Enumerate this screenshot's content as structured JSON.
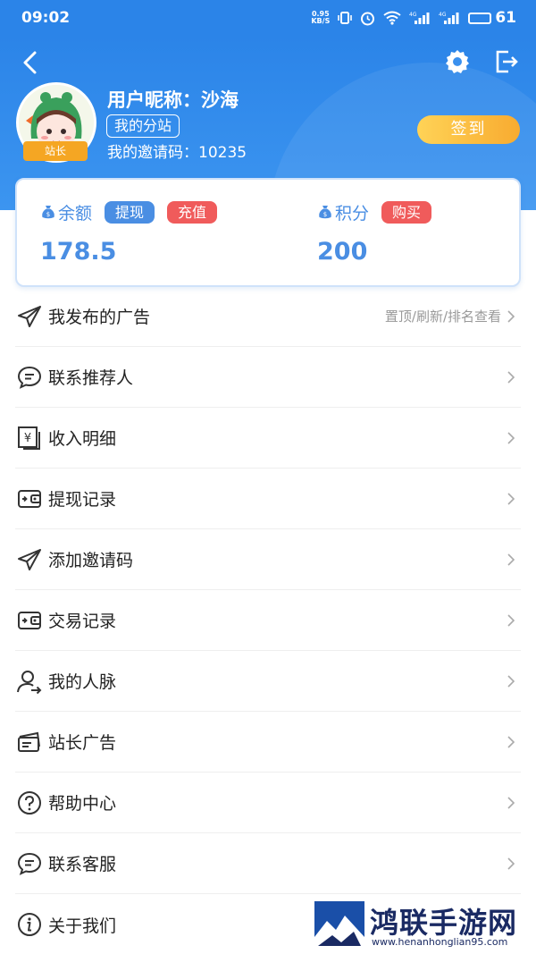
{
  "status_bar": {
    "time": "09:02",
    "net_speed_value": "0.95",
    "net_speed_unit": "KB/S",
    "battery": "61",
    "icons": [
      "vibrate-icon",
      "alarm-icon",
      "wifi-icon",
      "signal-4g-icon",
      "signal-4g-icon"
    ]
  },
  "header": {
    "nickname": "用户昵称：沙海",
    "substation_label": "我的分站",
    "invite_code": "我的邀请码：10235",
    "role_badge": "站长",
    "signin_label": "签到",
    "icons": [
      "back-icon",
      "gear-icon",
      "logout-icon"
    ]
  },
  "balance": {
    "left": {
      "title": "余额",
      "btn1": "提现",
      "btn2": "充值",
      "value": "178.5"
    },
    "right": {
      "title": "积分",
      "btn1": "购买",
      "value": "200"
    }
  },
  "menu": [
    {
      "label": "我发布的广告",
      "hint": "置顶/刷新/排名查看",
      "icon": "send-icon"
    },
    {
      "label": "联系推荐人",
      "hint": "",
      "icon": "chat-icon"
    },
    {
      "label": "收入明细",
      "hint": "",
      "icon": "yuan-doc-icon"
    },
    {
      "label": "提现记录",
      "hint": "",
      "icon": "wallet-icon"
    },
    {
      "label": "添加邀请码",
      "hint": "",
      "icon": "send-icon"
    },
    {
      "label": "交易记录",
      "hint": "",
      "icon": "wallet-icon"
    },
    {
      "label": "我的人脉",
      "hint": "",
      "icon": "user-arrow-icon"
    },
    {
      "label": "站长广告",
      "hint": "",
      "icon": "card-icon"
    },
    {
      "label": "帮助中心",
      "hint": "",
      "icon": "help-icon"
    },
    {
      "label": "联系客服",
      "hint": "",
      "icon": "chat-icon"
    },
    {
      "label": "关于我们",
      "hint": "",
      "icon": "info-icon"
    }
  ],
  "watermark": {
    "title": "鸿联手游网",
    "url": "www.henanhonglian95.com"
  },
  "colors": {
    "header_blue": "#2b84e8",
    "accent_blue": "#4a8ee3",
    "red": "#f05b5b",
    "gold": "#f8a521"
  }
}
